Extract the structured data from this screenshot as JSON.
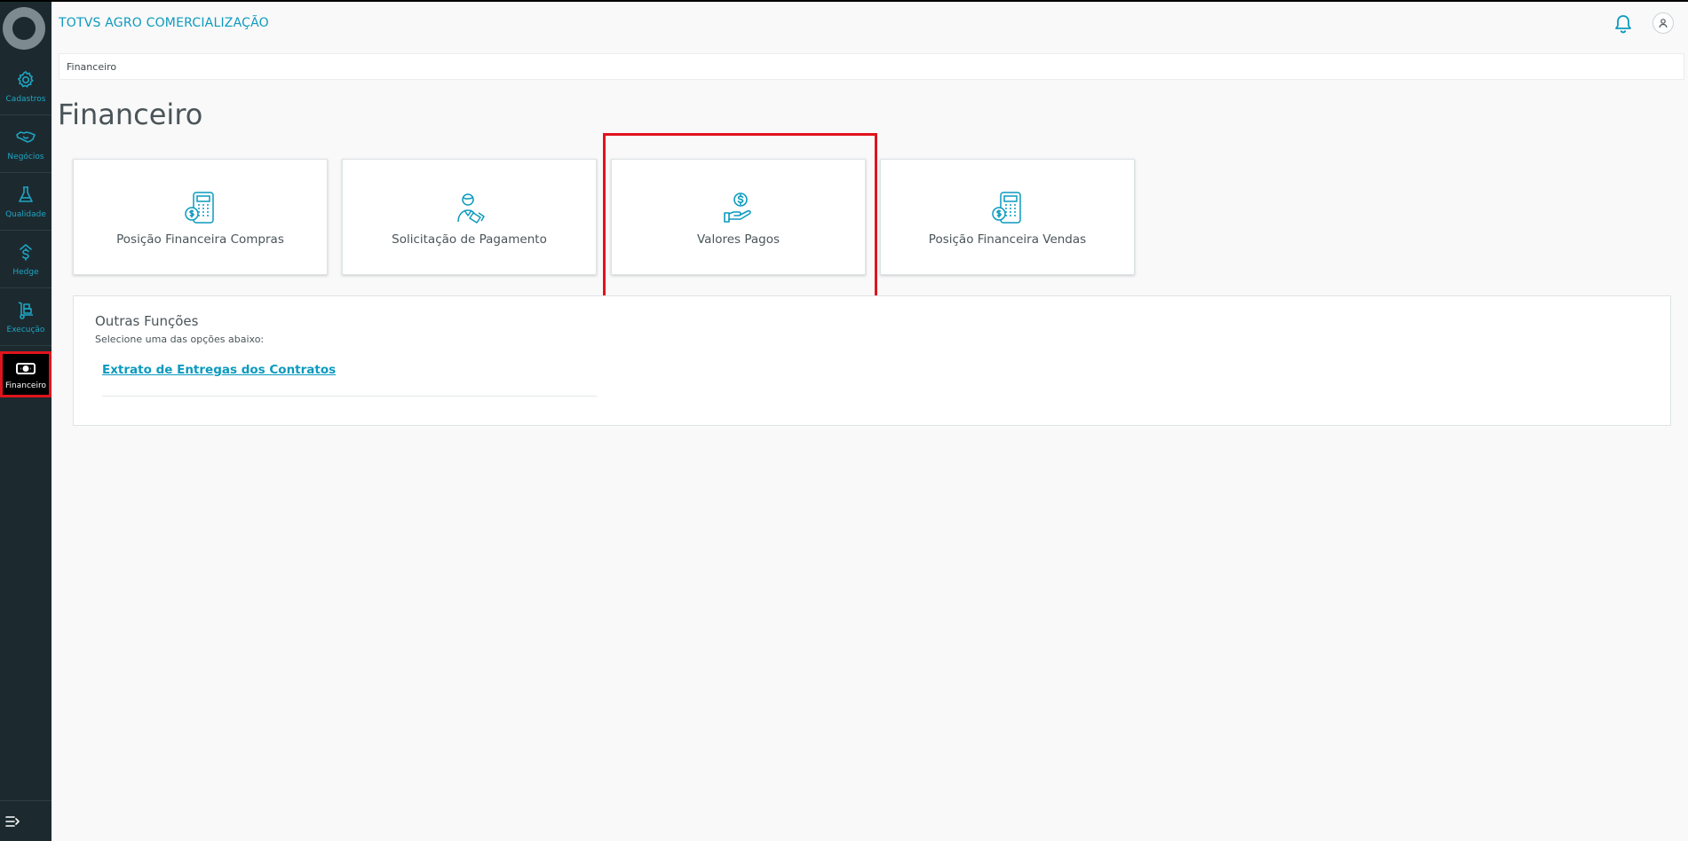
{
  "header": {
    "app_title": "TOTVS AGRO COMERCIALIZAÇÃO"
  },
  "sidebar": {
    "items": [
      {
        "label": "Cadastros",
        "icon": "gear-icon"
      },
      {
        "label": "Negócios",
        "icon": "handshake-icon"
      },
      {
        "label": "Qualidade",
        "icon": "flask-icon"
      },
      {
        "label": "Hedge",
        "icon": "hedge-dollar-icon"
      },
      {
        "label": "Execução",
        "icon": "hand-truck-icon"
      },
      {
        "label": "Financeiro",
        "icon": "money-bill-icon",
        "active": true
      }
    ]
  },
  "breadcrumb": {
    "current": "Financeiro"
  },
  "page": {
    "title": "Financeiro"
  },
  "cards": [
    {
      "label": "Posição Financeira Compras",
      "icon": "calculator-coin-icon"
    },
    {
      "label": "Solicitação de Pagamento",
      "icon": "person-document-icon"
    },
    {
      "label": "Valores Pagos",
      "icon": "hand-coin-icon",
      "highlighted": true
    },
    {
      "label": "Posição Financeira Vendas",
      "icon": "calculator-coin-icon"
    }
  ],
  "other_functions": {
    "title": "Outras Funções",
    "subtitle": "Selecione uma das opções abaixo:",
    "links": [
      "Extrato de Entregas dos Contratos"
    ]
  },
  "colors": {
    "accent": "#0c9abe",
    "sidebar_bg": "#1c2a30",
    "highlight": "#e0141c"
  }
}
